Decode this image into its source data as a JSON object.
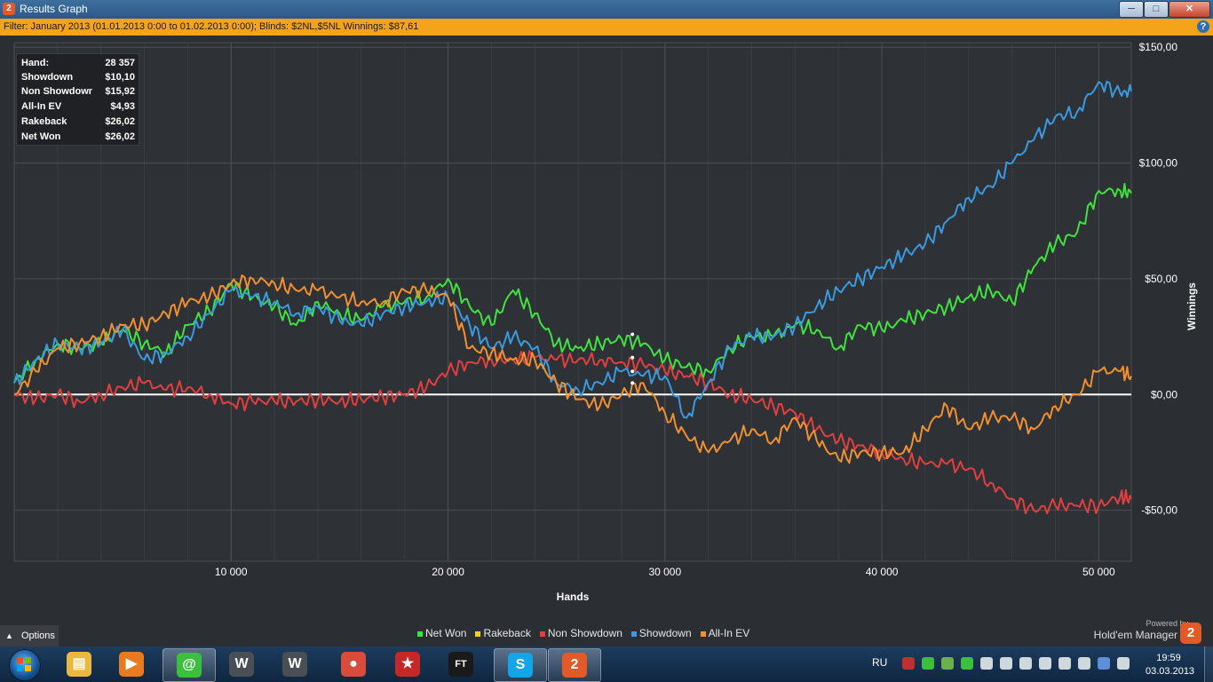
{
  "window": {
    "title": "Results Graph",
    "app_icon_label": "2",
    "controls": {
      "minimize": "─",
      "maximize": "□",
      "close": "✕"
    }
  },
  "filter": {
    "text": "Filter: January 2013 (01.01.2013 0:00 to 01.02.2013 0:00); Blinds: $2NL,$5NL  Winnings: $87,61",
    "help_icon": "?"
  },
  "stats": [
    {
      "label": "Hand:",
      "value": "28 357"
    },
    {
      "label": "Showdown",
      "value": "$10,10"
    },
    {
      "label": "Non Showdown",
      "value": "$15,92"
    },
    {
      "label": "All-In EV",
      "value": "$4,93"
    },
    {
      "label": "Rakeback",
      "value": "$26,02"
    },
    {
      "label": "Net Won",
      "value": "$26,02"
    }
  ],
  "options": {
    "label": "Options",
    "icon": "chevron-up-icon"
  },
  "branding": {
    "powered": "Powered by",
    "name": "Hold'em Manager",
    "logo": "2"
  },
  "chart_data": {
    "type": "line",
    "xlabel": "Hands",
    "ylabel": "Winnings",
    "xlim": [
      0,
      51500
    ],
    "ylim": [
      -72,
      152
    ],
    "x_ticks": [
      {
        "value": 10000,
        "label": "10 000"
      },
      {
        "value": 20000,
        "label": "20 000"
      },
      {
        "value": 30000,
        "label": "30 000"
      },
      {
        "value": 40000,
        "label": "40 000"
      },
      {
        "value": 50000,
        "label": "50 000"
      }
    ],
    "y_ticks": [
      {
        "value": 150,
        "label": "$150,00"
      },
      {
        "value": 100,
        "label": "$100,00"
      },
      {
        "value": 50,
        "label": "$50,00"
      },
      {
        "value": 0,
        "label": "$0,00"
      },
      {
        "value": -50,
        "label": "-$50,00"
      }
    ],
    "grid": true,
    "legend_position": "bottom",
    "series": [
      {
        "name": "Net Won",
        "color": "#3fe23f",
        "x": [
          0,
          1000,
          2000,
          3000,
          4000,
          5000,
          6000,
          7000,
          8000,
          9000,
          10000,
          11000,
          12000,
          13000,
          14000,
          15000,
          16000,
          17000,
          18000,
          19000,
          20000,
          21000,
          22000,
          23000,
          24000,
          25000,
          26000,
          27000,
          28000,
          29000,
          30000,
          31000,
          32000,
          33000,
          34000,
          35000,
          36000,
          37000,
          38000,
          39000,
          40000,
          41000,
          42000,
          43000,
          44000,
          45000,
          46000,
          47000,
          48000,
          49000,
          50000,
          51000,
          51500
        ],
        "y": [
          5,
          15,
          22,
          20,
          22,
          28,
          22,
          18,
          30,
          36,
          48,
          42,
          38,
          30,
          40,
          35,
          32,
          38,
          40,
          42,
          50,
          38,
          30,
          45,
          35,
          22,
          20,
          22,
          24,
          22,
          15,
          12,
          10,
          20,
          25,
          25,
          30,
          28,
          20,
          30,
          28,
          32,
          35,
          38,
          42,
          45,
          40,
          55,
          65,
          70,
          88,
          88,
          87
        ]
      },
      {
        "name": "Rakeback",
        "color": "#f0d020",
        "x": [
          0,
          51500
        ],
        "y": [
          0,
          0
        ]
      },
      {
        "name": "Non Showdown",
        "color": "#e04040",
        "x": [
          0,
          1000,
          2000,
          3000,
          4000,
          5000,
          6000,
          7000,
          8000,
          9000,
          10000,
          11000,
          12000,
          13000,
          14000,
          15000,
          16000,
          17000,
          18000,
          19000,
          20000,
          21000,
          22000,
          23000,
          24000,
          25000,
          26000,
          27000,
          28000,
          29000,
          30000,
          31000,
          32000,
          33000,
          34000,
          35000,
          36000,
          37000,
          38000,
          39000,
          40000,
          41000,
          42000,
          43000,
          44000,
          45000,
          46000,
          47000,
          48000,
          49000,
          50000,
          51000,
          51500
        ],
        "y": [
          0,
          -2,
          0,
          -3,
          0,
          3,
          5,
          2,
          3,
          0,
          -4,
          -3,
          -3,
          -3,
          -2,
          -3,
          -2,
          -1,
          0,
          3,
          10,
          14,
          15,
          15,
          16,
          15,
          15,
          15,
          14,
          13,
          10,
          8,
          5,
          0,
          -2,
          -5,
          -8,
          -15,
          -20,
          -22,
          -25,
          -28,
          -30,
          -30,
          -32,
          -38,
          -45,
          -50,
          -48,
          -48,
          -48,
          -44,
          -45
        ]
      },
      {
        "name": "Showdown",
        "color": "#3a9ae0",
        "x": [
          0,
          1000,
          2000,
          3000,
          4000,
          5000,
          6000,
          7000,
          8000,
          9000,
          10000,
          11000,
          12000,
          13000,
          14000,
          15000,
          16000,
          17000,
          18000,
          19000,
          20000,
          21000,
          22000,
          23000,
          24000,
          25000,
          26000,
          27000,
          28000,
          29000,
          30000,
          31000,
          32000,
          33000,
          34000,
          35000,
          36000,
          37000,
          38000,
          39000,
          40000,
          41000,
          42000,
          43000,
          44000,
          45000,
          46000,
          47000,
          48000,
          49000,
          50000,
          51000,
          51500
        ],
        "y": [
          5,
          15,
          22,
          20,
          22,
          28,
          15,
          18,
          25,
          35,
          45,
          42,
          40,
          35,
          38,
          32,
          30,
          35,
          38,
          40,
          42,
          30,
          20,
          25,
          20,
          5,
          2,
          5,
          10,
          8,
          8,
          -10,
          5,
          20,
          25,
          25,
          30,
          38,
          45,
          50,
          55,
          60,
          65,
          75,
          85,
          90,
          100,
          110,
          120,
          122,
          135,
          130,
          131
        ]
      },
      {
        "name": "All-In EV",
        "color": "#f09030",
        "x": [
          0,
          1000,
          2000,
          3000,
          4000,
          5000,
          6000,
          7000,
          8000,
          9000,
          10000,
          11000,
          12000,
          13000,
          14000,
          15000,
          16000,
          17000,
          18000,
          19000,
          20000,
          21000,
          22000,
          23000,
          24000,
          25000,
          26000,
          27000,
          28000,
          29000,
          30000,
          31000,
          32000,
          33000,
          34000,
          35000,
          36000,
          37000,
          38000,
          39000,
          40000,
          41000,
          42000,
          43000,
          44000,
          45000,
          46000,
          47000,
          48000,
          49000,
          50000,
          51000,
          51500
        ],
        "y": [
          0,
          10,
          20,
          22,
          25,
          30,
          30,
          35,
          40,
          42,
          48,
          50,
          48,
          45,
          45,
          42,
          40,
          40,
          45,
          45,
          42,
          20,
          18,
          15,
          15,
          5,
          -2,
          -5,
          0,
          5,
          -8,
          -18,
          -25,
          -20,
          -15,
          -20,
          -10,
          -20,
          -28,
          -25,
          -25,
          -25,
          -15,
          -5,
          -15,
          -10,
          -10,
          -15,
          -5,
          0,
          10,
          10,
          8
        ]
      }
    ],
    "markers": [
      {
        "series": "Net Won",
        "x": 28500,
        "y": 26
      },
      {
        "series": "Non Showdown",
        "x": 28500,
        "y": 16
      },
      {
        "series": "Showdown",
        "x": 28500,
        "y": 10
      },
      {
        "series": "All-In EV",
        "x": 28500,
        "y": 5
      }
    ]
  },
  "taskbar": {
    "items": [
      {
        "name": "explorer",
        "color": "#e8b840",
        "glyph": "▤"
      },
      {
        "name": "media-player",
        "color": "#e87a20",
        "glyph": "▶"
      },
      {
        "name": "mail-agent",
        "color": "#3cbf3c",
        "glyph": "@"
      },
      {
        "name": "world-of-tanks",
        "color": "#4a4f55",
        "glyph": "W"
      },
      {
        "name": "world-of-tanks-2",
        "color": "#4a4f55",
        "glyph": "W"
      },
      {
        "name": "chrome",
        "color": "#d94b3a",
        "glyph": "●"
      },
      {
        "name": "pokerstars",
        "color": "#c62828",
        "glyph": "★"
      },
      {
        "name": "full-tilt",
        "color": "#1a1a1a",
        "glyph": "FT"
      },
      {
        "name": "skype",
        "color": "#12a5e8",
        "glyph": "S"
      },
      {
        "name": "holdem-manager",
        "color": "#e35a28",
        "glyph": "2"
      }
    ],
    "language": "RU",
    "tray": [
      "#c03030",
      "#3cbf3c",
      "#6ab04c",
      "#3cbf3c",
      "#cfd8dc",
      "#cfd8dc",
      "#cfd8dc",
      "#cfd8dc",
      "#cfd8dc",
      "#cfd8dc",
      "#5f8fd6",
      "#cfd8dc"
    ],
    "time": "19:59",
    "date": "03.03.2013"
  }
}
